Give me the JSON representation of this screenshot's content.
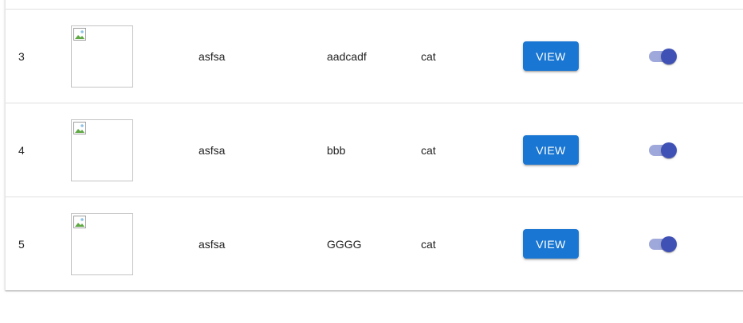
{
  "table": {
    "rows": [
      {
        "id": "3",
        "name": "asfsa",
        "description": "aadcadf",
        "category": "cat",
        "action_label": "VIEW",
        "enabled": true
      },
      {
        "id": "4",
        "name": "asfsa",
        "description": "bbb",
        "category": "cat",
        "action_label": "VIEW",
        "enabled": true
      },
      {
        "id": "5",
        "name": "asfsa",
        "description": "GGGG",
        "category": "cat",
        "action_label": "VIEW",
        "enabled": true
      }
    ]
  },
  "colors": {
    "button_primary": "#1976d2",
    "switch_thumb": "#3f51b5",
    "switch_track": "#9fa8da",
    "divider": "#e0e0e0"
  },
  "icons": {
    "thumbnail": "broken-image-icon"
  }
}
